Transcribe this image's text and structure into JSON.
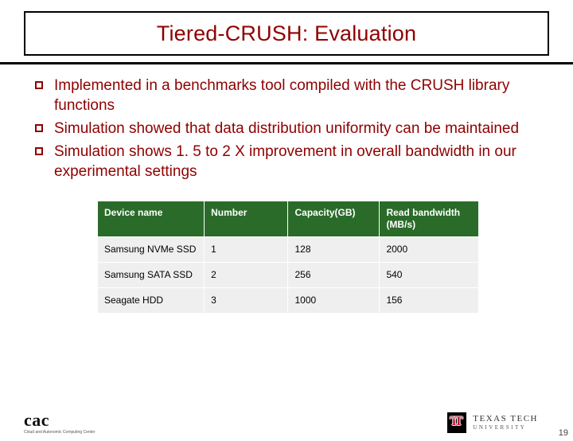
{
  "title": "Tiered-CRUSH: Evaluation",
  "bullets": [
    "Implemented in a benchmarks tool compiled with the CRUSH library functions",
    "Simulation showed that data distribution uniformity can be maintained",
    "Simulation shows 1. 5 to 2 X improvement in overall bandwidth in our experimental settings"
  ],
  "table": {
    "headers": [
      "Device name",
      "Number",
      "Capacity(GB)",
      "Read bandwidth (MB/s)"
    ],
    "rows": [
      [
        "Samsung NVMe SSD",
        "1",
        "128",
        "2000"
      ],
      [
        "Samsung SATA SSD",
        "2",
        "256",
        "540"
      ],
      [
        "Seagate HDD",
        "3",
        "1000",
        "156"
      ]
    ]
  },
  "footer": {
    "left_logo": "cac",
    "left_sub": "Cloud and Autonomic Computing Center",
    "right_l1": "TEXAS TECH",
    "right_l2": "UNIVERSITY",
    "page": "19"
  }
}
